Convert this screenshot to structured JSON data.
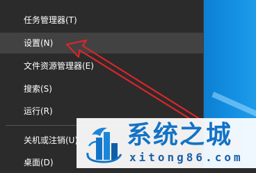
{
  "menu": {
    "items": [
      {
        "label": "任务管理器(T)"
      },
      {
        "label": "设置(N)"
      },
      {
        "label": "文件资源管理器(E)"
      },
      {
        "label": "搜索(S)"
      },
      {
        "label": "运行(R)"
      },
      {
        "label": "关机或注销(U)"
      },
      {
        "label": "桌面(D)"
      }
    ],
    "highlighted_item": "设置(N)"
  },
  "annotation": {
    "arrow_color": "#d9262b",
    "points_to": "设置(N)"
  },
  "watermark": {
    "title": "系统之城",
    "domain": "xitong86.com"
  },
  "colors": {
    "menu_bg": "#2b2b2b",
    "menu_hover": "#424242",
    "menu_text": "#ffffff",
    "desktop_blue": "#138fe2",
    "watermark_blue": "#1273c6"
  }
}
